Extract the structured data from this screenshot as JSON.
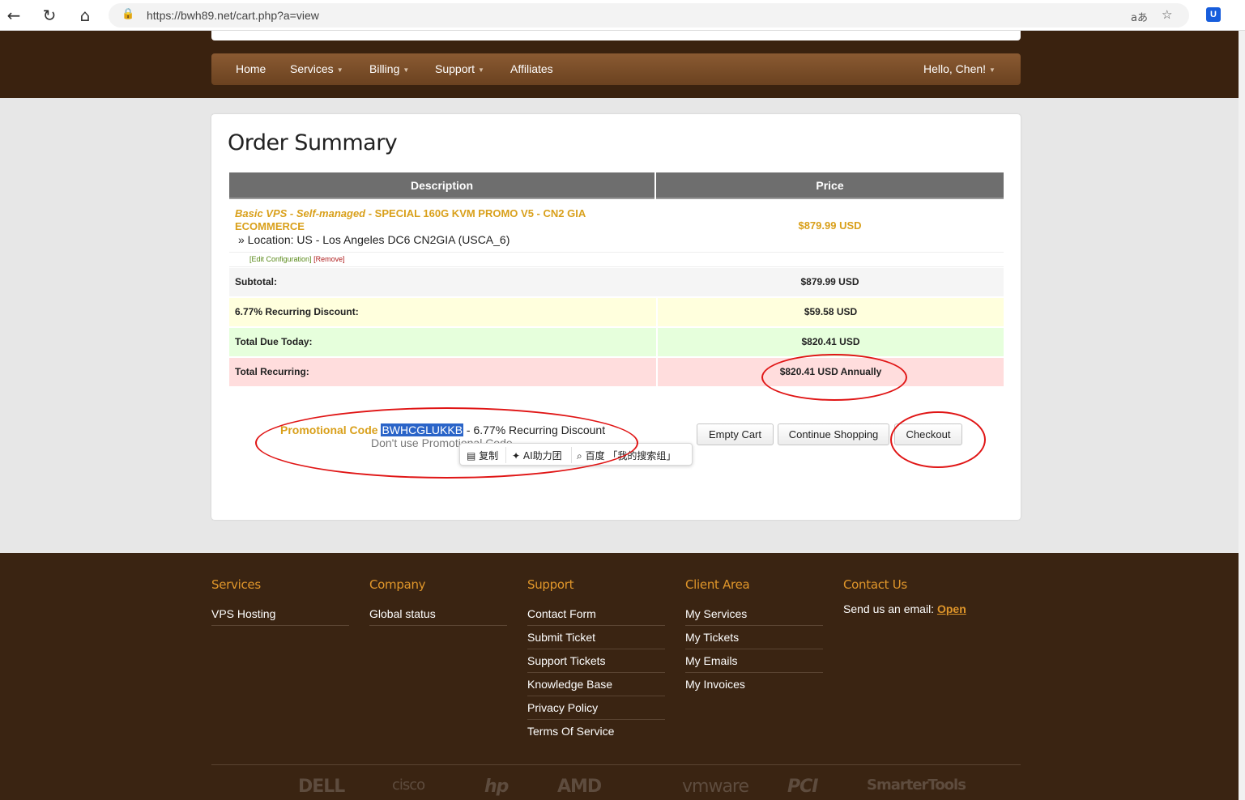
{
  "browser": {
    "url": "https://bwh89.net/cart.php?a=view",
    "back_icon": "←",
    "reload_icon": "↻",
    "home_icon": "⌂",
    "lock_icon": "🔒",
    "translate_icon": "aあ",
    "star_icon": "☆",
    "ext_icon": "U"
  },
  "nav": {
    "home": "Home",
    "services": "Services",
    "billing": "Billing",
    "support": "Support",
    "affiliates": "Affiliates",
    "user": "Hello, Chen!",
    "caret": "▼"
  },
  "order": {
    "title": "Order Summary",
    "col_description": "Description",
    "col_price": "Price",
    "product_prefix": "Basic VPS - Self-managed",
    "product_name": " - SPECIAL 160G KVM PROMO V5 - CN2 GIA ECOMMERCE",
    "product_location": "» Location: US - Los Angeles DC6 CN2GIA (USCA_6)",
    "edit_link": "[Edit Configuration]",
    "remove_link": "[Remove]",
    "product_price": "$879.99 USD",
    "subtotal_label": "Subtotal:",
    "subtotal_value": "$879.99 USD",
    "discount_label": "6.77% Recurring Discount:",
    "discount_value": "$59.58 USD",
    "total_due_label": "Total Due Today:",
    "total_due_value": "$820.41 USD",
    "recurring_label": "Total Recurring:",
    "recurring_value": "$820.41 USD Annually",
    "promo_label": "Promotional Code",
    "promo_code": "BWHCGLUKKB",
    "promo_desc": " - 6.77% Recurring Discount",
    "promo_remove": "Don't use Promotional Code",
    "empty_cart": "Empty Cart",
    "continue_shopping": "Continue Shopping",
    "checkout": "Checkout"
  },
  "context_menu": {
    "copy_icon": "▤",
    "copy": "复制",
    "ai_icon": "✦",
    "ai": "AI助力团",
    "search_icon": "⌕",
    "search": "百度 「我的搜索组」"
  },
  "footer": {
    "services_head": "Services",
    "services_links": [
      "VPS Hosting"
    ],
    "company_head": "Company",
    "company_links": [
      "Global status"
    ],
    "support_head": "Support",
    "support_links": [
      "Contact Form",
      "Submit Ticket",
      "Support Tickets",
      "Knowledge Base",
      "Privacy Policy",
      "Terms Of Service"
    ],
    "client_head": "Client Area",
    "client_links": [
      "My Services",
      "My Tickets",
      "My Emails",
      "My Invoices"
    ],
    "contact_head": "Contact Us",
    "contact_text": "Send us an email: ",
    "contact_open": "Open",
    "logos": [
      "DELL",
      "cisco",
      "hp",
      "AMD",
      "vmware",
      "PCI",
      "SmarterTools"
    ]
  },
  "colors": {
    "header_bg": "#3a220f",
    "accent": "#d9a01b",
    "annotation": "#e01515",
    "discount_row": "#ffffdd",
    "total_row": "#e6ffdc",
    "recurring_row": "#ffdddd"
  }
}
